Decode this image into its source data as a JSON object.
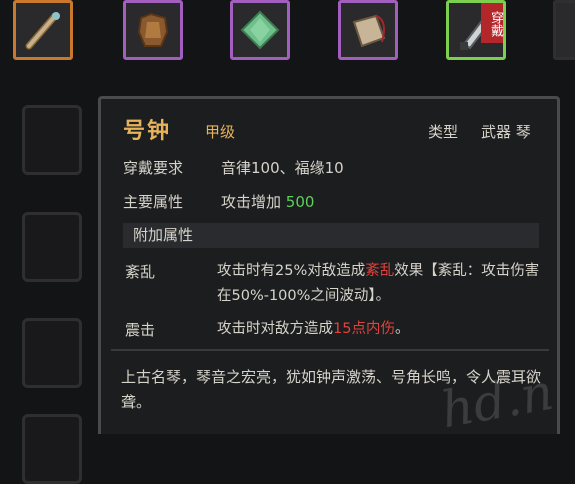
{
  "inventory": {
    "slots": [
      {
        "name": "flute",
        "border": "#c9782c"
      },
      {
        "name": "armor",
        "border": "#a35fbf"
      },
      {
        "name": "gem",
        "border": "#a35fbf"
      },
      {
        "name": "bag",
        "border": "#a35fbf"
      },
      {
        "name": "weapon",
        "border": "#7ccf4f"
      }
    ],
    "equipped_badge": "穿戴"
  },
  "tooltip": {
    "title": "号钟",
    "grade": "甲级",
    "type_label": "类型",
    "type_value": "武器 琴",
    "requirement_label": "穿戴要求",
    "requirement_value": "音律100、福缘10",
    "main_attr_label": "主要属性",
    "main_attr_text": "攻击增加",
    "main_attr_value": "500",
    "section_title": "附加属性",
    "effects": [
      {
        "name": "紊乱",
        "desc_pre": "攻击时有25%对敌造成",
        "desc_highlight": "紊乱",
        "desc_post": "效果【紊乱：攻击伤害在50%-100%之间波动】。"
      },
      {
        "name": "震击",
        "desc_pre": "攻击时对敌方造成",
        "desc_highlight": "15点内伤",
        "desc_post": "。"
      }
    ],
    "flavor_text": "上古名琴，琴音之宏亮，犹如钟声激荡、号角长鸣，令人震耳欲聋。"
  },
  "watermark": "hd.n",
  "colors": {
    "gold": "#e6b35a",
    "green": "#5fcf5c",
    "red": "#e2423b"
  }
}
